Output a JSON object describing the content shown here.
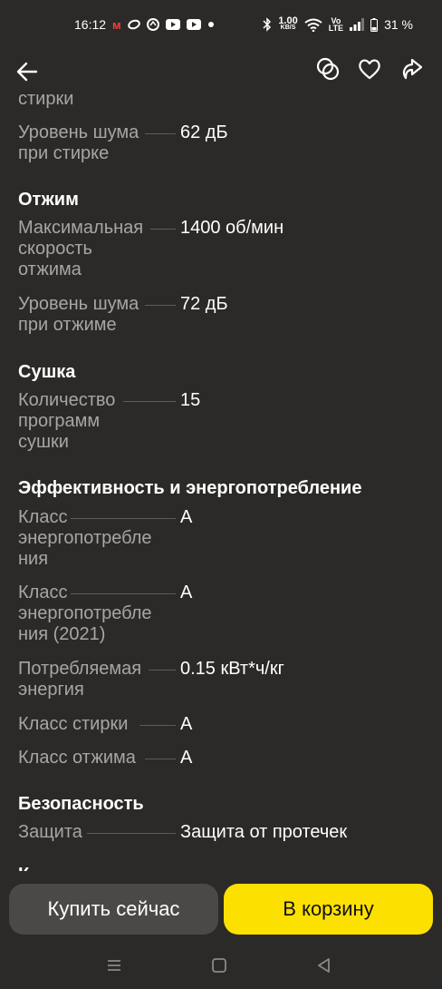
{
  "status": {
    "time": "16:12",
    "network_speed_value": "1.00",
    "network_speed_unit": "KB/S",
    "volte_top": "Vo",
    "volte_bottom": "LTE",
    "battery": "31 %"
  },
  "specs": {
    "clipped_top_label": "стирки",
    "noise_wash": {
      "label_l1": "Уровень шума",
      "label_l2": "при стирке",
      "value": "62 дБ"
    },
    "section_spin": "Отжим",
    "max_spin": {
      "label_l1": "Максимальная",
      "label_l2": "скорость",
      "label_l3": "отжима",
      "value": "1400 об/мин"
    },
    "noise_spin": {
      "label_l1": "Уровень шума",
      "label_l2": "при отжиме",
      "value": "72 дБ"
    },
    "section_dry": "Сушка",
    "dry_programs": {
      "label_l1": "Количество",
      "label_l2": "программ",
      "label_l3": "сушки",
      "value": "15"
    },
    "section_energy": "Эффективность и энергопотребление",
    "energy_class": {
      "label_l1": "Класс",
      "label_l2": "энергопотребле",
      "label_l3": "ния",
      "value": "A"
    },
    "energy_class_2021": {
      "label_l1": "Класс",
      "label_l2": "энергопотребле",
      "label_l3": "ния (2021)",
      "value": "A"
    },
    "energy_consumed": {
      "label_l1": "Потребляемая",
      "label_l2": "энергия",
      "value": "0.15 кВт*ч/кг"
    },
    "wash_class": {
      "label": "Класс стирки",
      "value": "A"
    },
    "spin_class": {
      "label": "Класс отжима",
      "value": "A"
    },
    "section_safety": "Безопасность",
    "protection": {
      "label": "Защита",
      "value": "Защита от протечек"
    },
    "clipped_bottom": "К"
  },
  "buttons": {
    "buy_now": "Купить сейчас",
    "add_to_cart": "В корзину"
  },
  "colors": {
    "background": "#2b2a28",
    "accent_yellow": "#fce000",
    "secondary_button": "#4a4947",
    "label_gray": "#a7a6a4"
  },
  "icons": {
    "back": "arrow-left-icon",
    "compare": "compare-circles-icon",
    "favorite": "heart-icon",
    "share": "share-icon"
  }
}
